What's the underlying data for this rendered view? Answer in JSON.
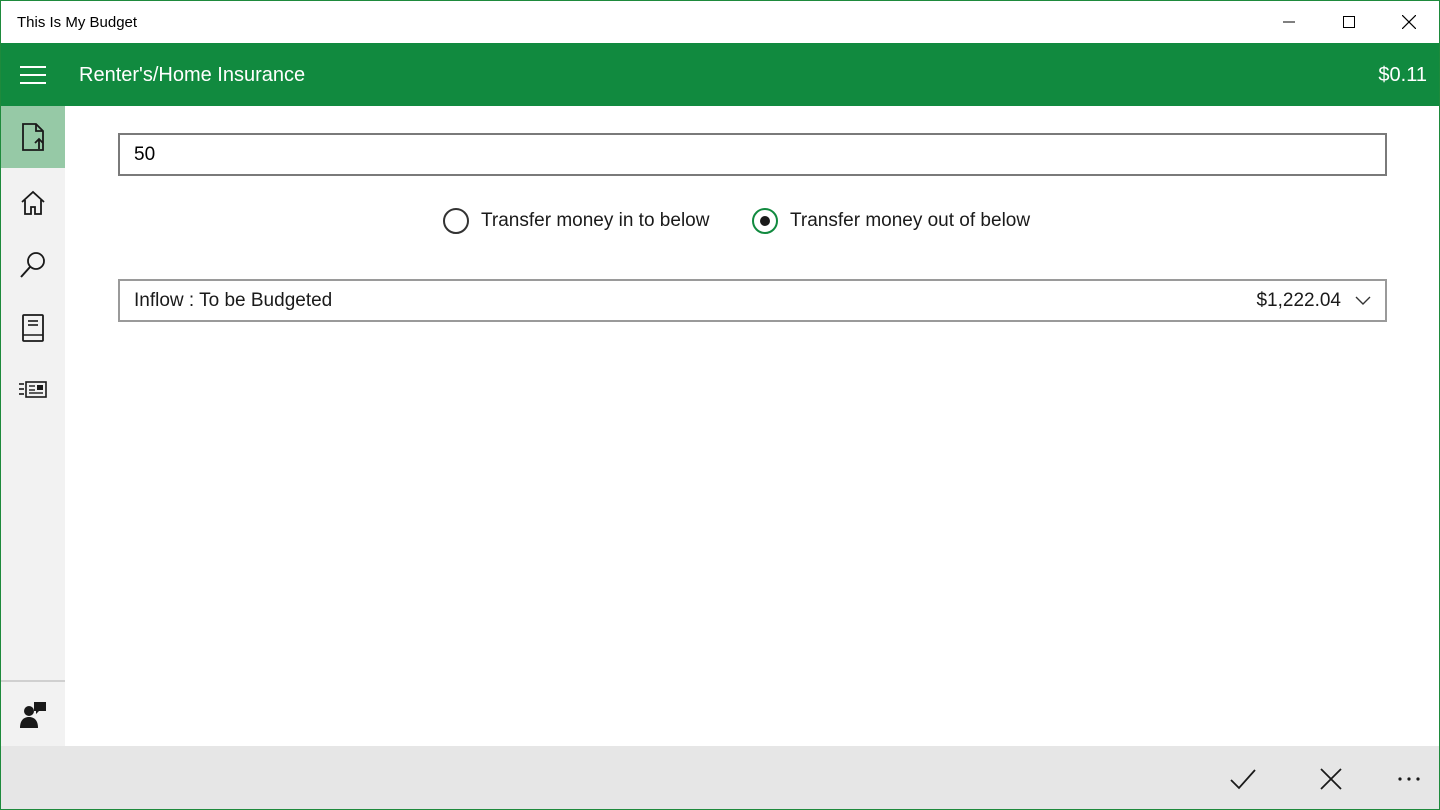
{
  "window": {
    "title": "This Is My Budget",
    "accent": "#118a3f"
  },
  "appbar": {
    "title": "Renter's/Home Insurance",
    "balance": "$0.11"
  },
  "sidebar": {
    "items": [
      {
        "icon": "document-upload-icon",
        "active": true
      },
      {
        "icon": "home-icon",
        "active": false
      },
      {
        "icon": "search-icon",
        "active": false
      },
      {
        "icon": "book-icon",
        "active": false
      },
      {
        "icon": "news-list-icon",
        "active": false
      }
    ],
    "footer_icon": "feedback-person-icon"
  },
  "form": {
    "amount_value": "50",
    "radio_in_label": "Transfer money in to below",
    "radio_out_label": "Transfer money out of below",
    "selected_radio": "out",
    "category_label": "Inflow : To be Budgeted",
    "category_amount": "$1,222.04"
  },
  "commands": {
    "accept_icon": "checkmark-icon",
    "cancel_icon": "close-icon",
    "more_icon": "more-ellipsis-icon"
  }
}
